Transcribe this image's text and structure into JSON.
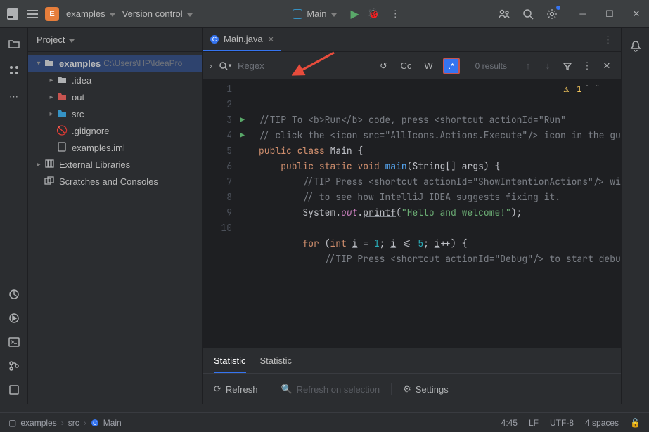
{
  "titlebar": {
    "project_badge": "E",
    "project_name": "examples",
    "vcs_menu": "Version control",
    "run_config": "Main"
  },
  "project_panel": {
    "title": "Project",
    "root_name": "examples",
    "root_path": "C:\\Users\\HP\\IdeaPro",
    "nodes": {
      "idea": ".idea",
      "out": "out",
      "src": "src",
      "gitignore": ".gitignore",
      "iml": "examples.iml",
      "ext_lib": "External Libraries",
      "scratches": "Scratches and Consoles"
    }
  },
  "editor": {
    "tab_label": "Main.java",
    "find": {
      "placeholder": "Regex",
      "cc": "Cc",
      "word": "W",
      "regex": ".*",
      "results": "0 results"
    },
    "warning_count": "1",
    "code": {
      "l1a": "//TIP To ",
      "l1b": "<b>Run</b>",
      "l1c": " code, press ",
      "l1d": "<shortcut actionId=\"Run\"",
      "l2": "// click the <icon src=\"AllIcons.Actions.Execute\"/> icon in the gu",
      "l3a": "public",
      "l3b": "class",
      "l3c": "Main",
      "l3d": "{",
      "l4a": "public",
      "l4b": "static",
      "l4c": "void",
      "l4d": "main",
      "l4e": "(String[] args)",
      "l4f": "{",
      "l5": "//TIP Press <shortcut actionId=\"ShowIntentionActions\"/> wi",
      "l6": "// to see how IntelliJ IDEA suggests fixing it.",
      "l7a": "System.",
      "l7b": "out",
      "l7c": ".",
      "l7d": "printf",
      "l7e": "(",
      "l7f": "\"Hello and welcome!\"",
      "l7g": ");",
      "l9a": "for",
      "l9b": "(",
      "l9c": "int",
      "l9d": "i",
      "l9e": " = ",
      "l9f": "1",
      "l9g": "; ",
      "l9h": "i",
      "l9i": " <= ",
      "l9j": "5",
      "l9k": "; ",
      "l9l": "i",
      "l9m": "++) {",
      "l10": "//TIP Press <shortcut actionId=\"Debug\"/> to start debu"
    },
    "lines": [
      "1",
      "2",
      "3",
      "4",
      "5",
      "6",
      "7",
      "8",
      "9",
      "10"
    ]
  },
  "bottom": {
    "tab1": "Statistic",
    "tab2": "Statistic",
    "refresh": "Refresh",
    "refresh_sel": "Refresh on selection",
    "settings": "Settings"
  },
  "breadcrumb": {
    "p1": "examples",
    "p2": "src",
    "p3": "Main"
  },
  "status": {
    "pos": "4:45",
    "le": "LF",
    "enc": "UTF-8",
    "indent": "4 spaces"
  }
}
